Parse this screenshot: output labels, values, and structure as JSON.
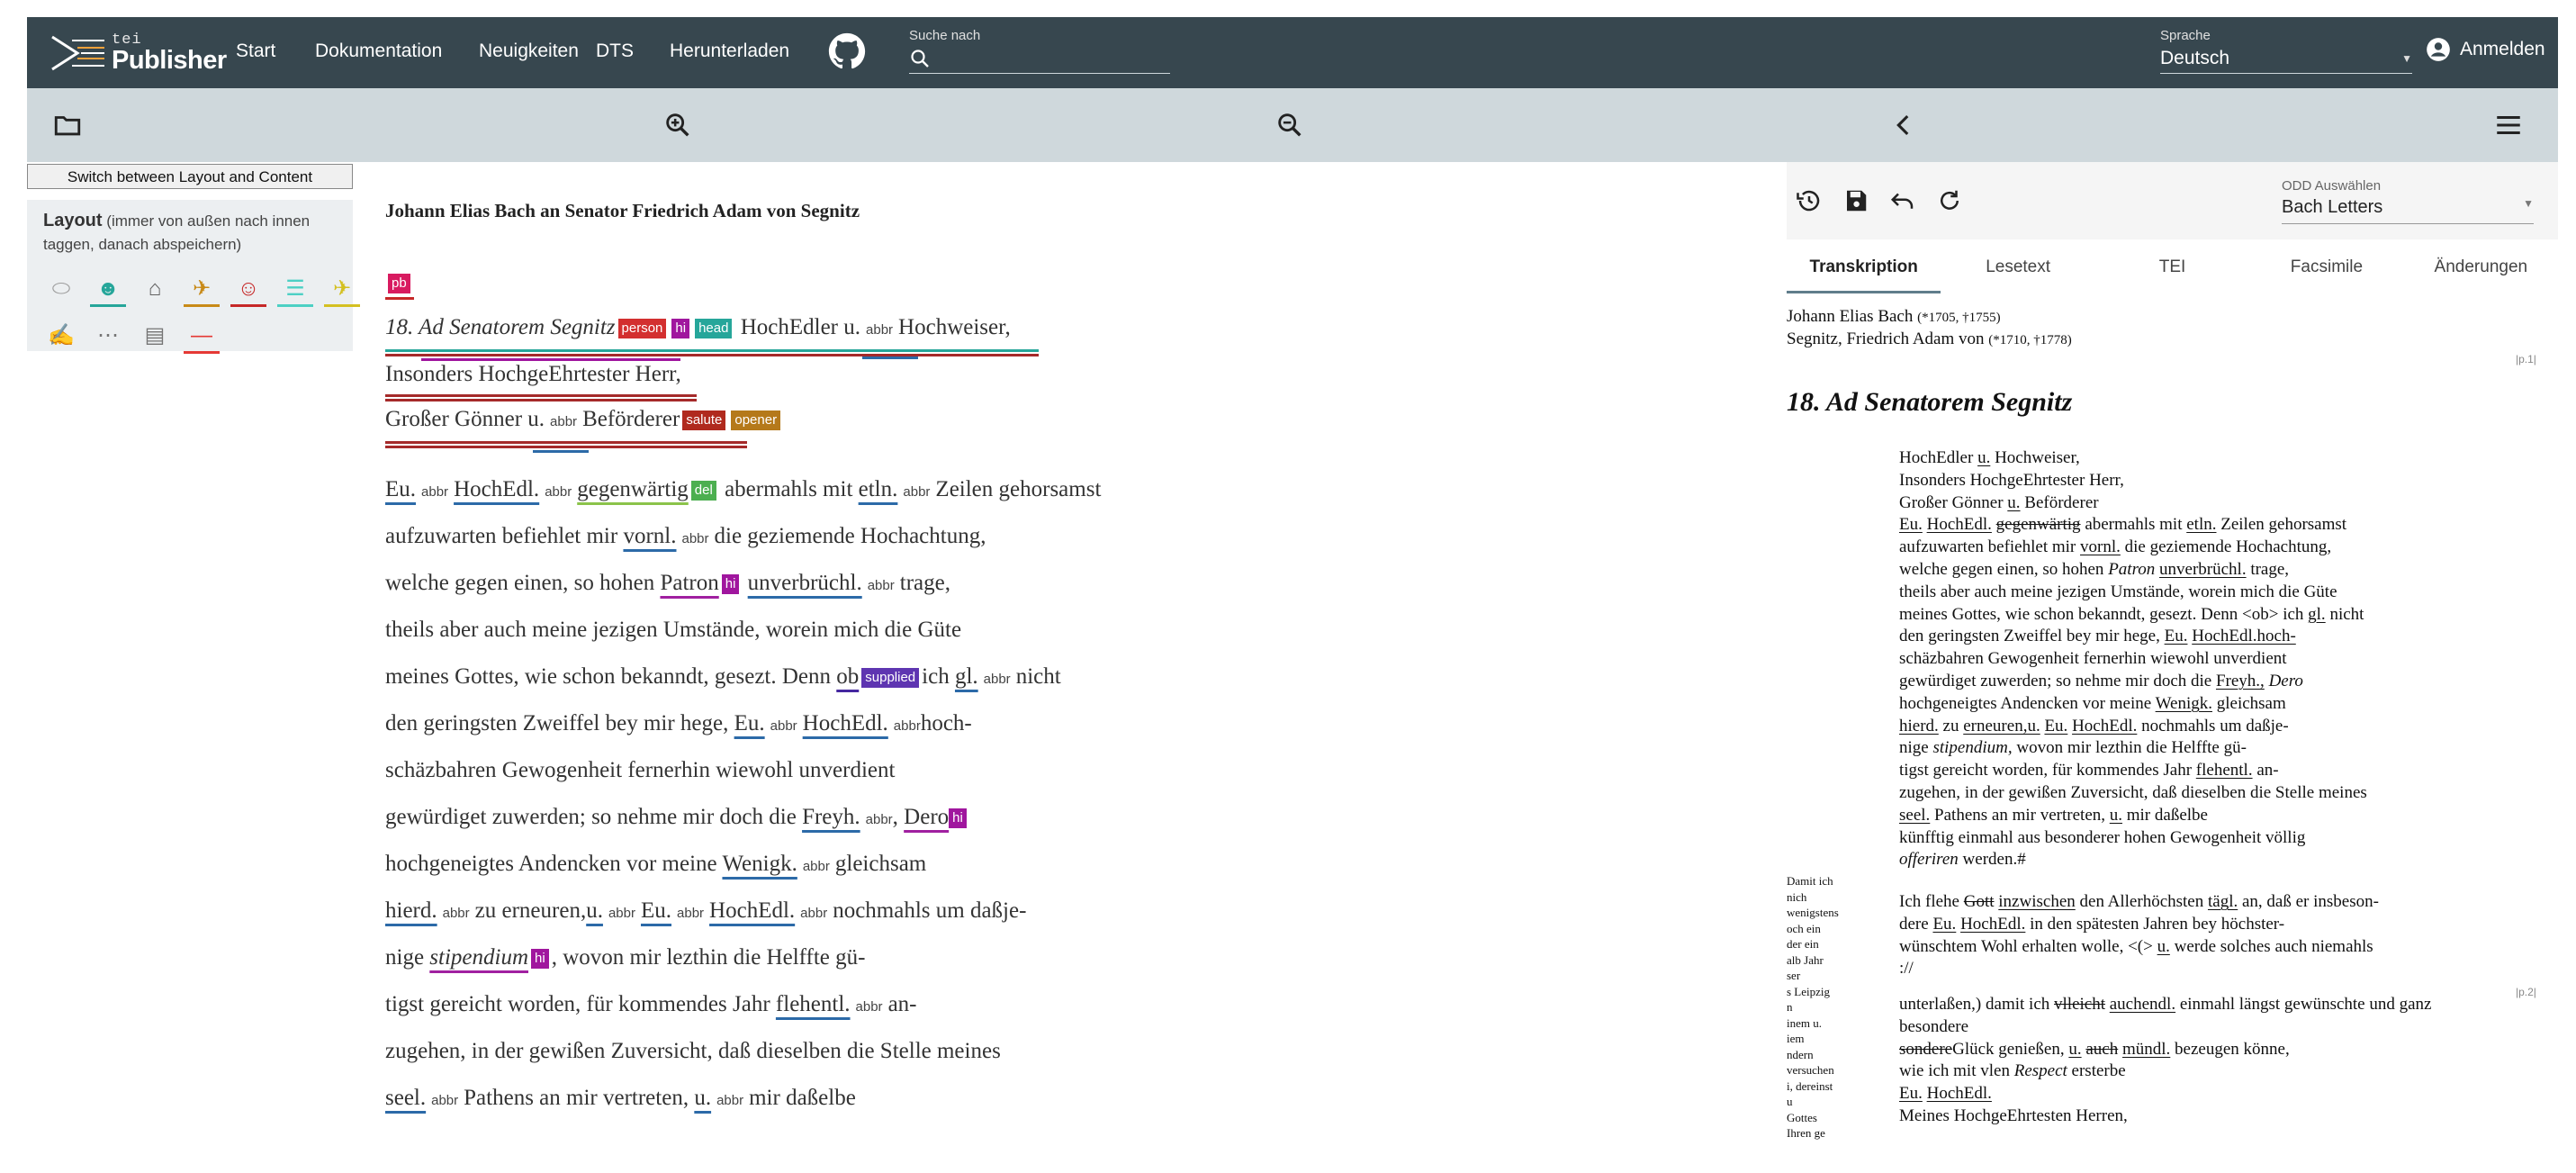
{
  "nav": {
    "logo_tei": "tei",
    "logo_publisher": "Publisher",
    "links": [
      "Start",
      "Dokumentation",
      "Neuigkeiten",
      "DTS",
      "Herunterladen"
    ],
    "search_label": "Suche nach",
    "search_value": "",
    "language_label": "Sprache",
    "language_value": "Deutsch",
    "login": "Anmelden"
  },
  "left_panel": {
    "switch_button": "Switch between Layout and Content",
    "layout_title": "Layout",
    "layout_hint": "(immer von außen nach innen taggen, danach abspeichern)",
    "icons": [
      "label-icon",
      "face-icon",
      "home-icon",
      "flight-takeoff-icon",
      "smiley-icon",
      "list-icon",
      "flight-land-icon",
      "signature-icon",
      "more-icon",
      "article-icon",
      "minus-icon"
    ],
    "icon_colors": [
      "#9e9e9e",
      "#26a69a",
      "#616161",
      "#c88a18",
      "#c62828",
      "#4dd0c4",
      "#d4c021",
      "#9e9e9e",
      "#757575",
      "#757575",
      "#e53935"
    ]
  },
  "document": {
    "title": "Johann Elias Bach an Senator Friedrich Adam von Segnitz",
    "pb_tag": "pb",
    "tags": {
      "person": "person",
      "hi": "hi",
      "head": "head",
      "abbr": "abbr",
      "salute": "salute",
      "opener": "opener",
      "del": "del",
      "supplied": "supplied"
    },
    "lines": {
      "l1a": "18. Ad Senatorem Segnitz",
      "l1b": "HochEdler",
      "l1c": "u.",
      "l1d": "Hochweiser,",
      "l2": "Insonders HochgeEhrtester Herr,",
      "l3a": "Großer Gönner",
      "l3b": "u.",
      "l3c": "Beförderer",
      "l4a": "Eu.",
      "l4b": "HochEdl.",
      "l4c": "gegenwärtig",
      "l4d": "abermahls mit",
      "l4e": "etln.",
      "l4f": "Zeilen gehorsamst",
      "l5a": "aufzuwarten befiehlet mir",
      "l5b": "vornl.",
      "l5c": "die geziemende Hochachtung,",
      "l6a": "welche gegen einen, so hohen",
      "l6b": "Patron",
      "l6c": "unverbrüchl.",
      "l6d": "trage,",
      "l7": "theils aber auch meine jezigen Umstände, worein mich die Güte",
      "l8a": "meines Gottes, wie schon bekanndt, gesezt. Denn",
      "l8b": "ob",
      "l8c": "ich",
      "l8d": "gl.",
      "l8e": "nicht",
      "l9a": "den geringsten Zweiffel bey mir hege,",
      "l9b": "Eu.",
      "l9c": "HochEdl.",
      "l9d": "hoch-",
      "l10": "schäzbahren Gewogenheit fernerhin wiewohl unverdient",
      "l11a": "gewürdiget zuwerden; so nehme mir doch die",
      "l11b": "Freyh.",
      "l11c": ",",
      "l11d": "Dero",
      "l12a": "hochgeneigtes Andencken vor meine",
      "l12b": "Wenigk.",
      "l12c": "gleichsam",
      "l13a": "hierd.",
      "l13b": "zu erneuren,",
      "l13c": "u.",
      "l13d": "Eu.",
      "l13e": "HochEdl.",
      "l13f": "nochmahls um daßje-",
      "l14a": "nige",
      "l14b": "stipendium",
      "l14c": ", wovon mir lezthin die Helffte gü-",
      "l15a": "tigst gereicht worden, für kommendes Jahr",
      "l15b": "flehentl.",
      "l15c": "an-",
      "l16": "zugehen, in der gewißen Zuversicht, daß dieselben die Stelle meines",
      "l17a": "seel.",
      "l17b": "Pathens an mir vertreten,",
      "l17c": "u.",
      "l17d": "mir daßelbe"
    }
  },
  "right_panel": {
    "odd_label": "ODD Auswählen",
    "odd_value": "Bach Letters",
    "tabs": [
      "Transkription",
      "Lesetext",
      "TEI",
      "Facsimile",
      "Änderungen"
    ],
    "person1_name": "Johann Elias Bach",
    "person1_dates": "(*1705, †1755)",
    "person2_name": "Segnitz, Friedrich Adam von",
    "person2_dates": "(*1710, †1778)",
    "page1": "|p.1|",
    "page2": "|p.2|",
    "heading": "18. Ad Senatorem Segnitz",
    "body": [
      "HochEdler u. Hochweiser,",
      "Insonders HochgeEhrtester Herr,",
      "Großer Gönner u. Beförderer",
      "Eu. HochEdl. gegenwärtig abermahls mit etln. Zeilen gehorsamst",
      "aufzuwarten befiehlet mir vornl. die geziemende Hochachtung,",
      "welche gegen einen, so hohen Patron unverbrüchl. trage,",
      "theils aber auch meine jezigen Umstände, worein mich die Güte",
      "meines Gottes, wie schon bekanndt, gesezt. Denn <ob> ich gl. nicht",
      "den geringsten Zweiffel bey mir hege, Eu. HochEdl.hoch-",
      "schäzbahren Gewogenheit fernerhin wiewohl unverdient",
      "gewürdiget zuwerden; so nehme mir doch die Freyh., Dero",
      "hochgeneigtes Andencken vor meine Wenigk. gleichsam",
      "hierd. zu erneuren,u. Eu. HochEdl. nochmahls um daßje-",
      "nige stipendium, wovon mir lezthin die Helffte gü-",
      "tigst gereicht worden, für kommendes Jahr flehentl. an-",
      "zugehen, in der gewißen Zuversicht, daß dieselben die Stelle meines",
      "seel. Pathens an mir vertreten, u. mir daßelbe",
      "künfftig einmahl aus besonderer hohen Gewogenheit völlig",
      "offeriren werden.#"
    ],
    "body2": [
      "Ich flehe Gott inzwischen den Allerhöchsten tägl. an, daß er insbeson-",
      "dere Eu. HochEdl. in den spätesten Jahren bey höchster-",
      "wünschtem Wohl erhalten wolle, <(> u. werde solches auch niemahls",
      "://"
    ],
    "body3": [
      "unterlaßen,) damit ich vlleicht auchendl. einmahl längst gewünschte und ganz",
      "besondere",
      "sondereGlück genießen, u. auch mündl. bezeugen könne,",
      "wie ich mit vlen Respect ersterbe",
      "Eu. HochEdl.",
      "Meines HochgeEhrtesten Herren,"
    ],
    "margin_note": [
      "Damit ich",
      "nich",
      "wenigstens",
      "och ein",
      "der ein",
      "alb Jahr",
      "ser",
      "s Leipzig",
      "n",
      "inem u.",
      "iem",
      "ndern",
      "versuchen",
      "i, dereinst",
      "u",
      "Gottes",
      "Ihren ge"
    ]
  }
}
